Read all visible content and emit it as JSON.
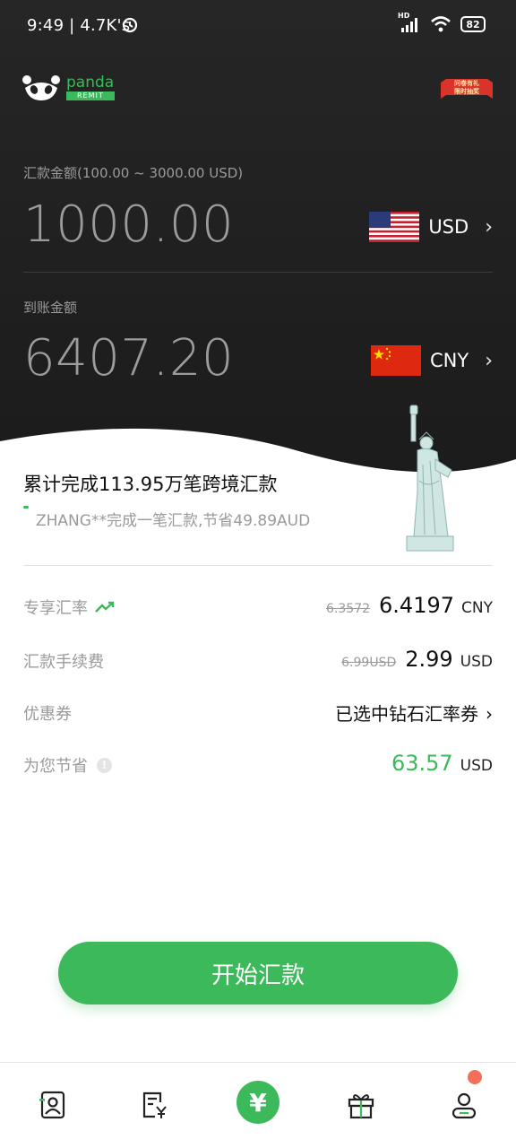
{
  "status_bar": {
    "time": "9:49 | 4.7K's",
    "network": "HD",
    "battery": "82"
  },
  "brand": {
    "name": "panda",
    "badge": "REMIT"
  },
  "promo": {
    "line1": "问卷有礼",
    "line2": "限时抽奖"
  },
  "send": {
    "label": "汇款金额(100.00 ~ 3000.00 USD)",
    "amount": "1000.00",
    "currency": "USD"
  },
  "receive": {
    "label": "到账金额",
    "amount": "6407.20",
    "currency": "CNY"
  },
  "stats": {
    "title": "累计完成113.95万笔跨境汇款",
    "ticker": "ZHANG**完成一笔汇款,节省49.89AUD"
  },
  "rows": {
    "rate": {
      "label": "专享汇率",
      "old": "6.3572",
      "value": "6.4197",
      "unit": "CNY"
    },
    "fee": {
      "label": "汇款手续费",
      "old": "6.99USD",
      "value": "2.99",
      "unit": "USD"
    },
    "coupon": {
      "label": "优惠券",
      "value": "已选中钻石汇率券"
    },
    "savings": {
      "label": "为您节省",
      "value": "63.57",
      "unit": "USD"
    }
  },
  "cta": {
    "label": "开始汇款"
  },
  "tabs": {
    "center_symbol": "¥"
  },
  "colors": {
    "accent": "#3cb95a",
    "hero_bg": "#1e1e1e",
    "notif": "#f2705a"
  }
}
